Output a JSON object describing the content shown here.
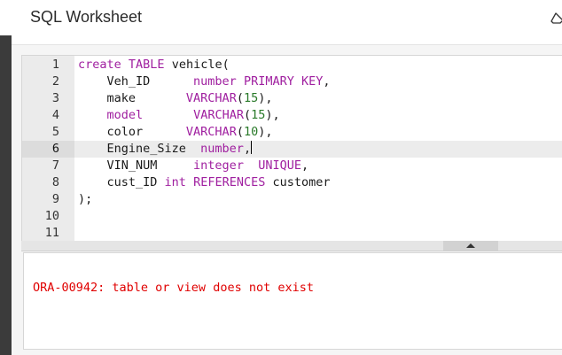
{
  "app": {
    "title": "SQL Worksheet",
    "accent_color": "#a020a0",
    "error_color": "#e00000"
  },
  "toolbar": {
    "clear_icon": "eraser-icon"
  },
  "editor": {
    "active_line": 6,
    "line_numbers": [
      "1",
      "2",
      "3",
      "4",
      "5",
      "6",
      "7",
      "8",
      "9",
      "10",
      "11"
    ],
    "lines": [
      [
        {
          "t": "create ",
          "c": "kw"
        },
        {
          "t": "TABLE ",
          "c": "kw"
        },
        {
          "t": "vehicle(",
          "c": ""
        }
      ],
      [
        {
          "t": "    Veh_ID      ",
          "c": ""
        },
        {
          "t": "number ",
          "c": "ty"
        },
        {
          "t": "PRIMARY KEY",
          "c": "kw"
        },
        {
          "t": ",",
          "c": ""
        }
      ],
      [
        {
          "t": "    make       ",
          "c": ""
        },
        {
          "t": "VARCHAR",
          "c": "ty"
        },
        {
          "t": "(",
          "c": ""
        },
        {
          "t": "15",
          "c": "num"
        },
        {
          "t": "),",
          "c": ""
        }
      ],
      [
        {
          "t": "    ",
          "c": ""
        },
        {
          "t": "model",
          "c": "kw"
        },
        {
          "t": "       ",
          "c": ""
        },
        {
          "t": "VARCHAR",
          "c": "ty"
        },
        {
          "t": "(",
          "c": ""
        },
        {
          "t": "15",
          "c": "num"
        },
        {
          "t": "),",
          "c": ""
        }
      ],
      [
        {
          "t": "    color      ",
          "c": ""
        },
        {
          "t": "VARCHAR",
          "c": "ty"
        },
        {
          "t": "(",
          "c": ""
        },
        {
          "t": "10",
          "c": "num"
        },
        {
          "t": "),",
          "c": ""
        }
      ],
      [
        {
          "t": "    Engine_Size  ",
          "c": ""
        },
        {
          "t": "number",
          "c": "ty"
        },
        {
          "t": ",",
          "c": ""
        },
        {
          "t": "|",
          "c": "cursor"
        }
      ],
      [
        {
          "t": "    VIN_NUM     ",
          "c": ""
        },
        {
          "t": "integer",
          "c": "ty"
        },
        {
          "t": "  ",
          "c": ""
        },
        {
          "t": "UNIQUE",
          "c": "kw"
        },
        {
          "t": ",",
          "c": ""
        }
      ],
      [
        {
          "t": "    cust_ID ",
          "c": ""
        },
        {
          "t": "int",
          "c": "ty"
        },
        {
          "t": " ",
          "c": ""
        },
        {
          "t": "REFERENCES",
          "c": "kw"
        },
        {
          "t": " customer",
          "c": ""
        }
      ],
      [
        {
          "t": ");",
          "c": ""
        }
      ],
      [],
      []
    ]
  },
  "output": {
    "message": "ORA-00942: table or view does not exist"
  }
}
